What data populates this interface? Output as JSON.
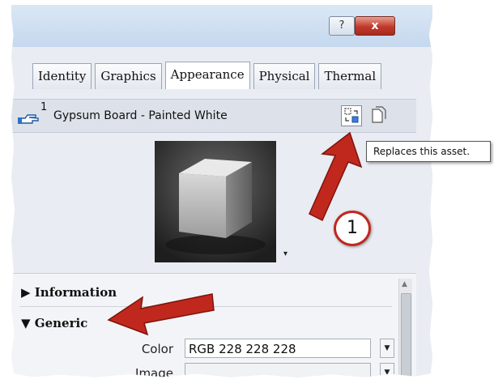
{
  "window": {
    "help_label": "?",
    "close_label": "x"
  },
  "tabs": [
    {
      "label": "Identity"
    },
    {
      "label": "Graphics"
    },
    {
      "label": "Appearance",
      "active": true
    },
    {
      "label": "Physical"
    },
    {
      "label": "Thermal"
    }
  ],
  "asset": {
    "users_count": "1",
    "name": "Gypsum Board - Painted White",
    "replace_icon": "replace-asset-icon",
    "duplicate_icon": "duplicate-asset-icon"
  },
  "tooltip": "Replaces this asset.",
  "preview": {
    "dropdown_glyph": "▾"
  },
  "sections": {
    "information": "Information",
    "generic": "Generic"
  },
  "properties": {
    "color_label": "Color",
    "color_value": "RGB 228 228 228",
    "image_label": "Image",
    "image_value": ""
  },
  "callout_number": "1",
  "colors": {
    "arrow_red": "#c1281d",
    "close_red": "#c0392b",
    "panel_bg": "#e9ecf2"
  }
}
